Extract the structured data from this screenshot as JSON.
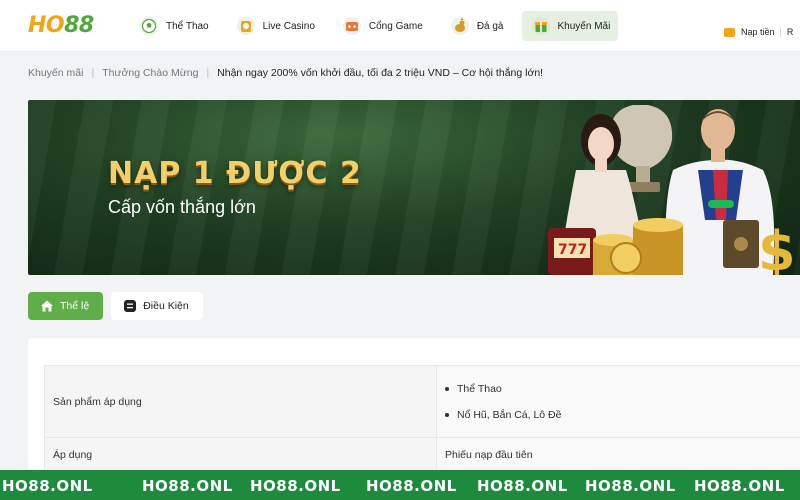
{
  "header": {
    "logo": {
      "part1": "HO",
      "part2": "88"
    },
    "nav": [
      {
        "label": "Thể Thao",
        "icon": "soccer-ball-icon"
      },
      {
        "label": "Live Casino",
        "icon": "casino-chip-icon"
      },
      {
        "label": "Cổng Game",
        "icon": "game-portal-icon"
      },
      {
        "label": "Đá gà",
        "icon": "rooster-icon"
      },
      {
        "label": "Khuyến Mãi",
        "icon": "gift-box-icon",
        "active": true
      }
    ],
    "topup_label": "Nạp tiền",
    "next_label_partial": "R"
  },
  "breadcrumb": {
    "items": [
      "Khuyến mãi",
      "Thưởng Chào Mừng"
    ],
    "current": "Nhận ngay 200% vốn khởi đầu, tối đa 2 triệu VND – Cơ hội thắng lớn!"
  },
  "banner": {
    "title": "NẠP 1 ĐƯỢC 2",
    "subtitle": "Cấp vốn thắng lớn"
  },
  "tabs": [
    {
      "label": "Thể lệ",
      "icon": "house-icon",
      "active": true
    },
    {
      "label": "Điều Kiện",
      "icon": "list-icon",
      "active": false
    }
  ],
  "rules": {
    "rows": [
      {
        "key": "Sản phẩm áp dụng",
        "values": [
          "Thể Thao",
          "Nổ Hũ, Bắn Cá, Lô Đề"
        ]
      },
      {
        "key": "Áp dụng",
        "value": "Phiếu nạp đầu tiên"
      }
    ]
  },
  "watermark": {
    "text": "HO88.ONL",
    "color": "#1e8a3e"
  },
  "colors": {
    "brand_green": "#5fae49",
    "brand_orange": "#f2a516"
  }
}
